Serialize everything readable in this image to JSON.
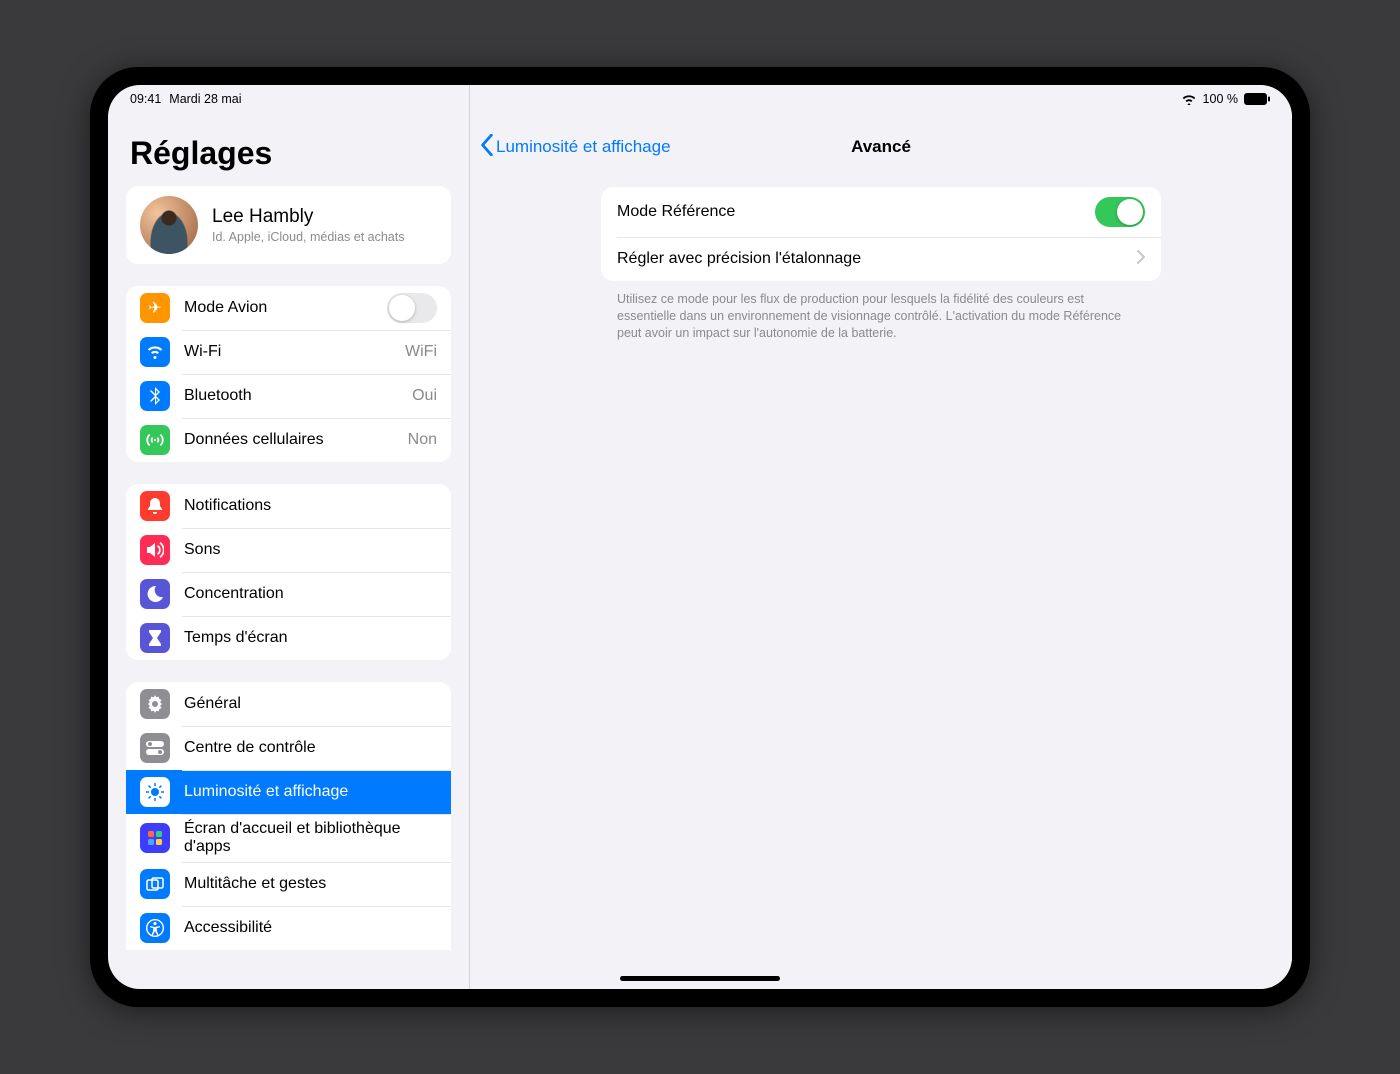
{
  "status": {
    "time": "09:41",
    "date": "Mardi 28 mai",
    "battery_text": "100 %"
  },
  "sidebar": {
    "title": "Réglages",
    "profile": {
      "name": "Lee Hambly",
      "subtitle": "Id. Apple, iCloud, médias et achats"
    },
    "group1": {
      "airplane": "Mode Avion",
      "wifi": "Wi-Fi",
      "wifi_value": "WiFi",
      "bluetooth": "Bluetooth",
      "bluetooth_value": "Oui",
      "cellular": "Données cellulaires",
      "cellular_value": "Non"
    },
    "group2": {
      "notifications": "Notifications",
      "sounds": "Sons",
      "focus": "Concentration",
      "screentime": "Temps d'écran"
    },
    "group3": {
      "general": "Général",
      "control_center": "Centre de contrôle",
      "display": "Luminosité et affichage",
      "home": "Écran d'accueil et bibliothèque d'apps",
      "multitask": "Multitâche et gestes",
      "accessibility": "Accessibilité"
    }
  },
  "detail": {
    "back_label": "Luminosité et affichage",
    "title": "Avancé",
    "reference_mode": "Mode Référence",
    "reference_on": true,
    "fine_tune": "Régler avec précision l'étalonnage",
    "footer": "Utilisez ce mode pour les flux de production pour lesquels la fidélité des couleurs est essentielle dans un environnement de visionnage contrôlé. L'activation du mode Référence peut avoir un impact sur l'autonomie de la batterie."
  }
}
